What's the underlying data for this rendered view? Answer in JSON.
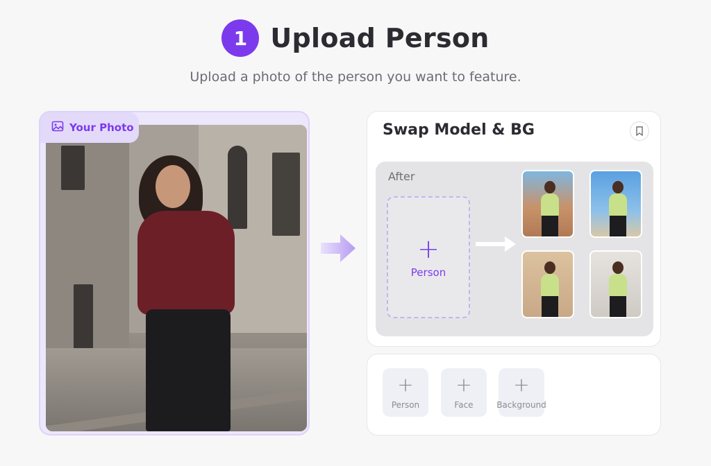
{
  "header": {
    "step_number": "1",
    "title": "Upload Person",
    "subtitle": "Upload a photo of the person you want to feature."
  },
  "photo_card": {
    "tab_label": "Your Photo",
    "tab_icon": "image-icon"
  },
  "swap_card": {
    "title": "Swap Model & BG",
    "bookmark_icon": "bookmark-icon",
    "after_label": "After",
    "drop_label": "Person",
    "drop_icon": "plus-icon"
  },
  "input_slots": [
    {
      "label": "Person",
      "icon": "plus-icon"
    },
    {
      "label": "Face",
      "icon": "plus-icon"
    },
    {
      "label": "Background",
      "icon": "plus-icon"
    }
  ],
  "colors": {
    "accent": "#7c3aed",
    "background": "#f7f7f8"
  }
}
